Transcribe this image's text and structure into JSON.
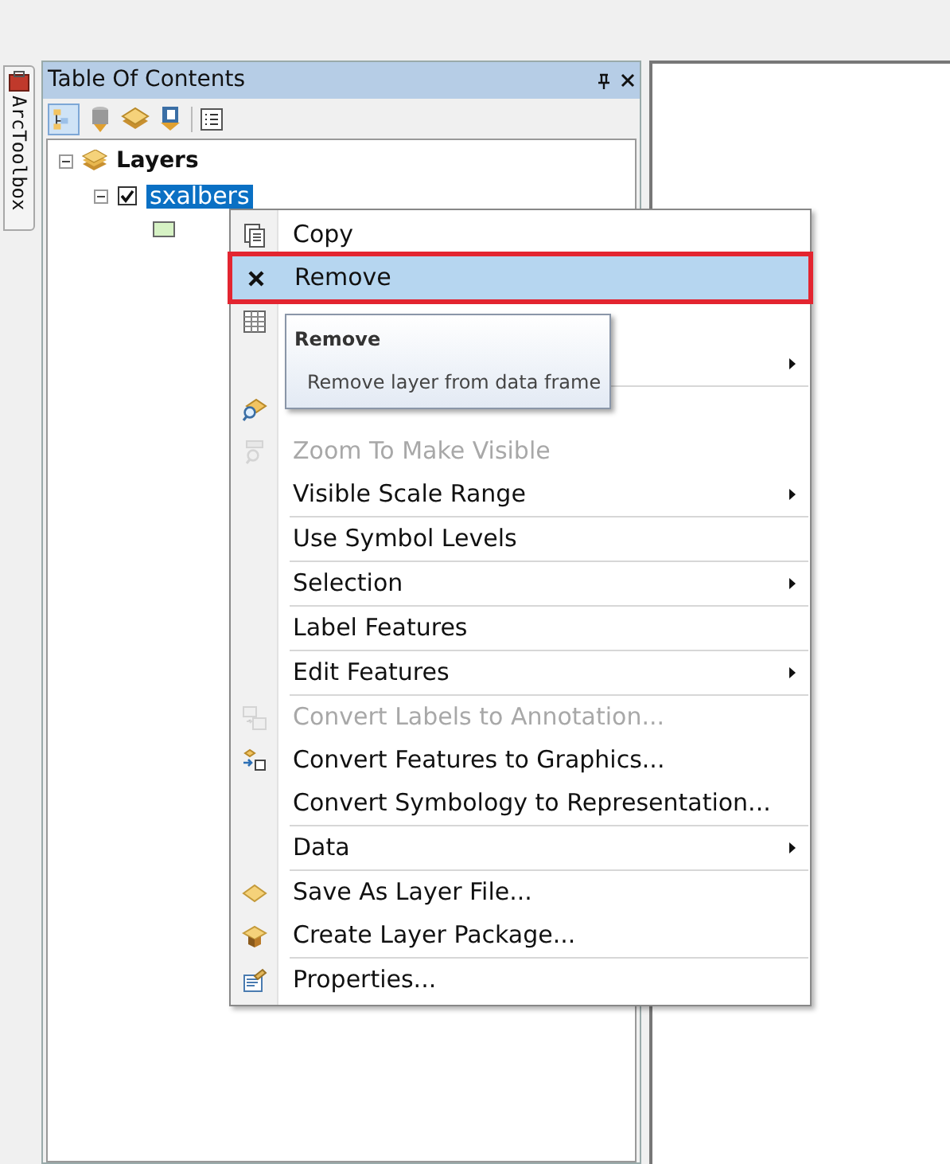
{
  "toolbox_tab": {
    "label": "ArcToolbox"
  },
  "toc": {
    "title": "Table Of Contents",
    "tree": [
      {
        "label": "Layers",
        "expanded": true,
        "children": [
          {
            "label": "sxalbers",
            "checked": true,
            "expanded": true,
            "selected": true
          }
        ]
      }
    ]
  },
  "menu": {
    "items": [
      {
        "kind": "copy",
        "label": "Copy",
        "disabled": false,
        "submenu": false,
        "selected": false
      },
      {
        "kind": "remove",
        "label": "Remove",
        "disabled": false,
        "submenu": false,
        "selected": true
      },
      {
        "kind": "table",
        "disabled": false,
        "submenu": false,
        "selected": false
      },
      {
        "kind": "plain",
        "disabled": false,
        "submenu": true,
        "selected": false
      },
      {
        "kind": "separator"
      },
      {
        "kind": "zoom",
        "disabled": false,
        "submenu": false,
        "selected": false
      },
      {
        "kind": "zoom-visible",
        "label": "Zoom To Make Visible",
        "disabled": true,
        "submenu": false,
        "selected": false
      },
      {
        "kind": "plain",
        "label": "Visible Scale Range",
        "disabled": false,
        "submenu": true,
        "selected": false
      },
      {
        "kind": "separator"
      },
      {
        "kind": "plain",
        "label": "Use Symbol Levels",
        "disabled": false,
        "submenu": false,
        "selected": false
      },
      {
        "kind": "separator"
      },
      {
        "kind": "plain",
        "label": "Selection",
        "disabled": false,
        "submenu": true,
        "selected": false
      },
      {
        "kind": "separator"
      },
      {
        "kind": "plain",
        "label": "Label Features",
        "disabled": false,
        "submenu": false,
        "selected": false
      },
      {
        "kind": "separator"
      },
      {
        "kind": "plain",
        "label": "Edit Features",
        "disabled": false,
        "submenu": true,
        "selected": false
      },
      {
        "kind": "separator"
      },
      {
        "kind": "convert-labels",
        "label": "Convert Labels to Annotation...",
        "disabled": true,
        "submenu": false,
        "selected": false
      },
      {
        "kind": "convert-features",
        "label": "Convert Features to Graphics...",
        "disabled": false,
        "submenu": false,
        "selected": false
      },
      {
        "kind": "plain",
        "label": "Convert Symbology to Representation...",
        "disabled": false,
        "submenu": false,
        "selected": false
      },
      {
        "kind": "separator"
      },
      {
        "kind": "plain",
        "label": "Data",
        "disabled": false,
        "submenu": true,
        "selected": false
      },
      {
        "kind": "separator"
      },
      {
        "kind": "layer-file",
        "label": "Save As Layer File...",
        "disabled": false,
        "submenu": false,
        "selected": false
      },
      {
        "kind": "package",
        "label": "Create Layer Package...",
        "disabled": false,
        "submenu": false,
        "selected": false
      },
      {
        "kind": "separator"
      },
      {
        "kind": "properties",
        "label": "Properties...",
        "disabled": false,
        "submenu": false,
        "selected": false
      }
    ]
  },
  "tooltip": {
    "title": "Remove",
    "text": "Remove layer from data frame"
  }
}
